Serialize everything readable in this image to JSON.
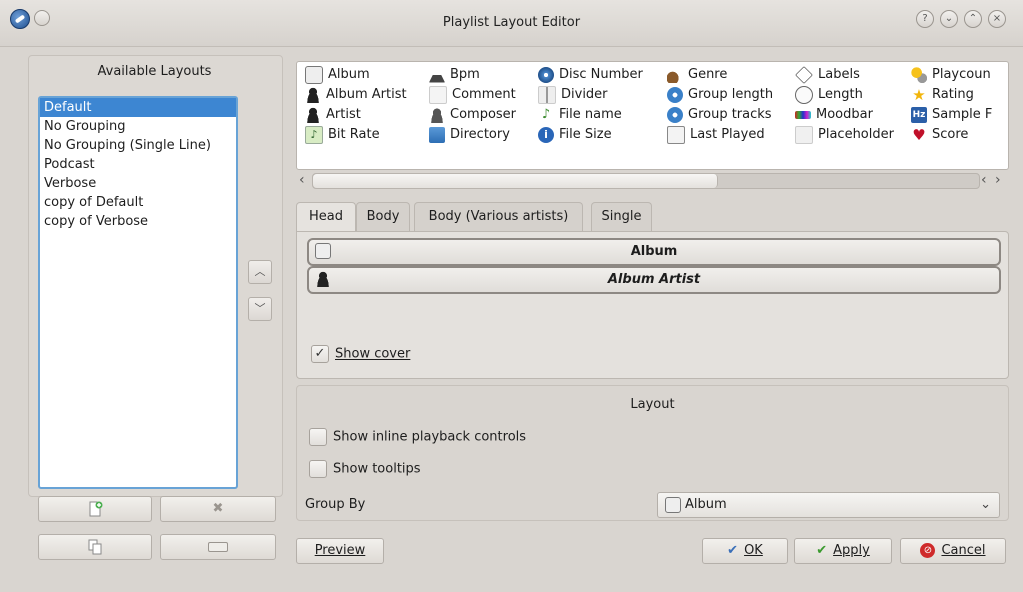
{
  "window": {
    "title": "Playlist Layout Editor",
    "controls": [
      "?",
      "⌄",
      "⌃",
      "×"
    ]
  },
  "left": {
    "title": "Available Layouts",
    "layouts": [
      "Default",
      "No Grouping",
      "No Grouping (Single Line)",
      "Podcast",
      "Verbose",
      "copy of Default",
      "copy of Verbose"
    ],
    "selected_index": 0
  },
  "tokens": [
    {
      "label": "Album",
      "icon": "cd-icon"
    },
    {
      "label": "Album Artist",
      "icon": "person-icon"
    },
    {
      "label": "Artist",
      "icon": "person-icon"
    },
    {
      "label": "Bit Rate",
      "icon": "music-note-icon"
    },
    {
      "label": "Bpm",
      "icon": "metronome-icon"
    },
    {
      "label": "Comment",
      "icon": "comment-icon"
    },
    {
      "label": "Composer",
      "icon": "composer-icon"
    },
    {
      "label": "Directory",
      "icon": "folder-icon"
    },
    {
      "label": "Disc Number",
      "icon": "disc-icon"
    },
    {
      "label": "Divider",
      "icon": "divider-icon"
    },
    {
      "label": "File name",
      "icon": "music-note-icon"
    },
    {
      "label": "File Size",
      "icon": "info-icon"
    },
    {
      "label": "Genre",
      "icon": "guitar-icon"
    },
    {
      "label": "Group length",
      "icon": "group-icon"
    },
    {
      "label": "Group tracks",
      "icon": "group-icon"
    },
    {
      "label": "Last Played",
      "icon": "calendar-icon"
    },
    {
      "label": "Labels",
      "icon": "tag-icon"
    },
    {
      "label": "Length",
      "icon": "clock-icon"
    },
    {
      "label": "Moodbar",
      "icon": "moodbar-icon"
    },
    {
      "label": "Placeholder",
      "icon": "placeholder-icon"
    },
    {
      "label": "Playcoun",
      "icon": "playcount-icon"
    },
    {
      "label": "Rating",
      "icon": "star-icon"
    },
    {
      "label": "Sample F",
      "icon": "hz-icon"
    },
    {
      "label": "Score",
      "icon": "heart-icon"
    }
  ],
  "tabs": [
    {
      "label": "Head",
      "active": true
    },
    {
      "label": "Body",
      "active": false
    },
    {
      "label": "Body (Various artists)",
      "active": false
    },
    {
      "label": "Single",
      "active": false
    }
  ],
  "head": {
    "rows": [
      "Album",
      "Album Artist"
    ],
    "show_cover": {
      "label": "Show cover",
      "checked": true
    }
  },
  "layout": {
    "title": "Layout",
    "inline_controls": {
      "label": "Show inline playback controls",
      "checked": false
    },
    "tooltips": {
      "label": "Show tooltips",
      "checked": false
    },
    "group_by_label": "Group By",
    "group_by_value": "Album"
  },
  "buttons": {
    "preview": "Preview",
    "ok": "OK",
    "apply": "Apply",
    "cancel": "Cancel"
  },
  "colors": {
    "selection": "#3d86d2",
    "list_border": "#68a3d6",
    "window_bg": "#d9d5d0"
  }
}
